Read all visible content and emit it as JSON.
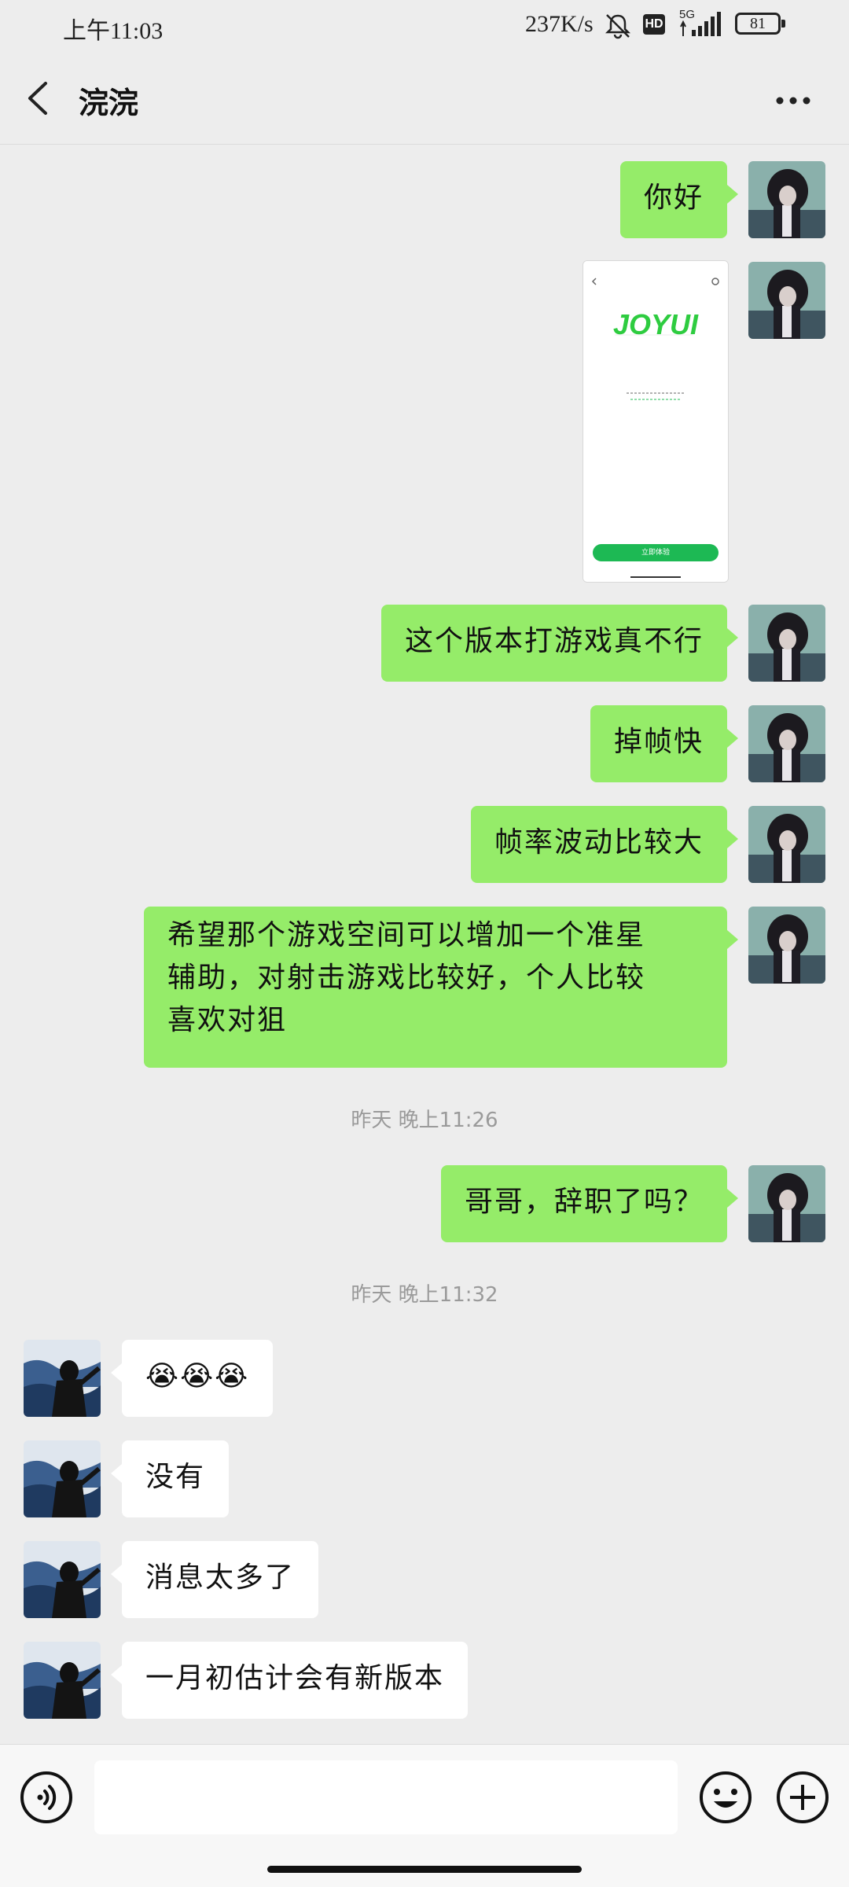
{
  "status_bar": {
    "time": "上午11:03",
    "net_speed": "237K/s",
    "hd": "HD",
    "signal_gen": "5G",
    "battery": "81"
  },
  "header": {
    "title": "浣浣"
  },
  "messages": [
    {
      "from": "me",
      "type": "text",
      "text": "你好"
    },
    {
      "from": "me",
      "type": "image",
      "image": {
        "logo": "JOYUI",
        "button": "立即体验"
      }
    },
    {
      "from": "me",
      "type": "text",
      "text": "这个版本打游戏真不行"
    },
    {
      "from": "me",
      "type": "text",
      "text": "掉帧快"
    },
    {
      "from": "me",
      "type": "text",
      "text": "帧率波动比较大"
    },
    {
      "from": "me",
      "type": "text",
      "lines": [
        "希望那个游戏空间可以增加一个准星",
        "辅助，对射击游戏比较好，个人比较",
        "喜欢对狙"
      ]
    },
    {
      "type": "timestamp",
      "text": "昨天 晚上11:26"
    },
    {
      "from": "me",
      "type": "text",
      "text": "哥哥，辞职了吗？"
    },
    {
      "type": "timestamp",
      "text": "昨天 晚上11:32"
    },
    {
      "from": "other",
      "type": "text",
      "text": "😭😭😭"
    },
    {
      "from": "other",
      "type": "text",
      "text": "没有"
    },
    {
      "from": "other",
      "type": "text",
      "text": "消息太多了"
    },
    {
      "from": "other",
      "type": "text",
      "text": "一月初估计会有新版本"
    }
  ],
  "icons": {
    "back": "chevron-left-icon",
    "more": "more-horizontal-icon",
    "voice": "voice-icon",
    "emoji": "emoji-icon",
    "plus": "plus-icon"
  },
  "colors": {
    "my_bubble": "#95ec69",
    "other_bubble": "#ffffff",
    "background": "#ededed"
  }
}
